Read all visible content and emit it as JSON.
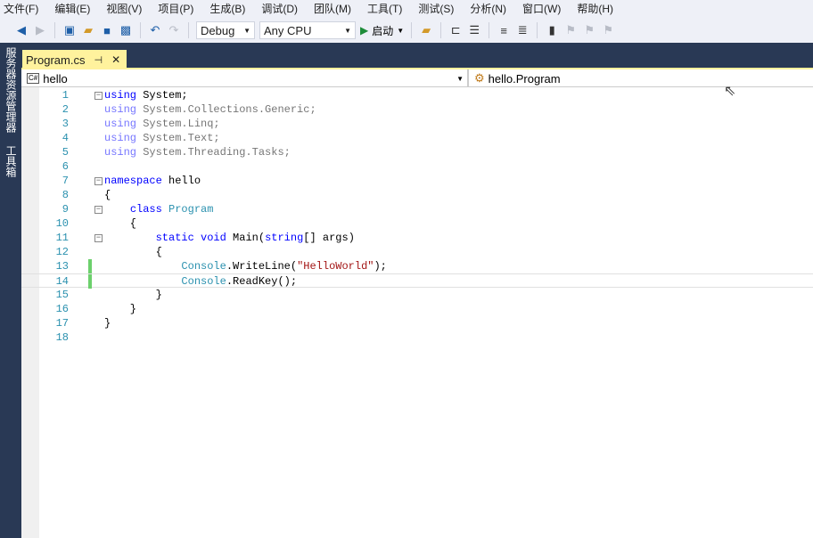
{
  "menu": [
    "文件(F)",
    "编辑(E)",
    "视图(V)",
    "项目(P)",
    "生成(B)",
    "调试(D)",
    "团队(M)",
    "工具(T)",
    "测试(S)",
    "分析(N)",
    "窗口(W)",
    "帮助(H)"
  ],
  "toolbar": {
    "config": "Debug",
    "platform": "Any CPU",
    "start": "启动"
  },
  "sidebar": [
    "服务器资源管理器",
    "工具箱"
  ],
  "tab": {
    "title": "Program.cs",
    "pin": "⊣",
    "close": "✕"
  },
  "nav": {
    "project": "hello",
    "type": "hello.Program",
    "lang": "C#"
  },
  "lines": [
    [
      [
        "kw",
        "using"
      ],
      [
        "tx",
        " System;"
      ]
    ],
    [
      [
        "kw",
        "using"
      ],
      [
        "tx",
        " System.Collections.Generic;"
      ]
    ],
    [
      [
        "kw",
        "using"
      ],
      [
        "tx",
        " System.Linq;"
      ]
    ],
    [
      [
        "kw",
        "using"
      ],
      [
        "tx",
        " System.Text;"
      ]
    ],
    [
      [
        "kw",
        "using"
      ],
      [
        "tx",
        " System.Threading.Tasks;"
      ]
    ],
    [],
    [
      [
        "kw",
        "namespace"
      ],
      [
        "tx",
        " hello"
      ]
    ],
    [
      [
        "tx",
        "{"
      ]
    ],
    [
      [
        "tx",
        "    "
      ],
      [
        "kw",
        "class"
      ],
      [
        "tx",
        " "
      ],
      [
        "ty",
        "Program"
      ]
    ],
    [
      [
        "tx",
        "    {"
      ]
    ],
    [
      [
        "tx",
        "        "
      ],
      [
        "kw",
        "static"
      ],
      [
        "tx",
        " "
      ],
      [
        "kw",
        "void"
      ],
      [
        "tx",
        " Main("
      ],
      [
        "kw",
        "string"
      ],
      [
        "tx",
        "[] args)"
      ]
    ],
    [
      [
        "tx",
        "        {"
      ]
    ],
    [
      [
        "tx",
        "            "
      ],
      [
        "ty",
        "Console"
      ],
      [
        "tx",
        ".WriteLine("
      ],
      [
        "st",
        "\"HelloWorld\""
      ],
      [
        "tx",
        ");"
      ]
    ],
    [
      [
        "tx",
        "            "
      ],
      [
        "ty",
        "Console"
      ],
      [
        "tx",
        ".ReadKey();"
      ]
    ],
    [
      [
        "tx",
        "        }"
      ]
    ],
    [
      [
        "tx",
        "    }"
      ]
    ],
    [
      [
        "tx",
        "}"
      ]
    ],
    []
  ]
}
